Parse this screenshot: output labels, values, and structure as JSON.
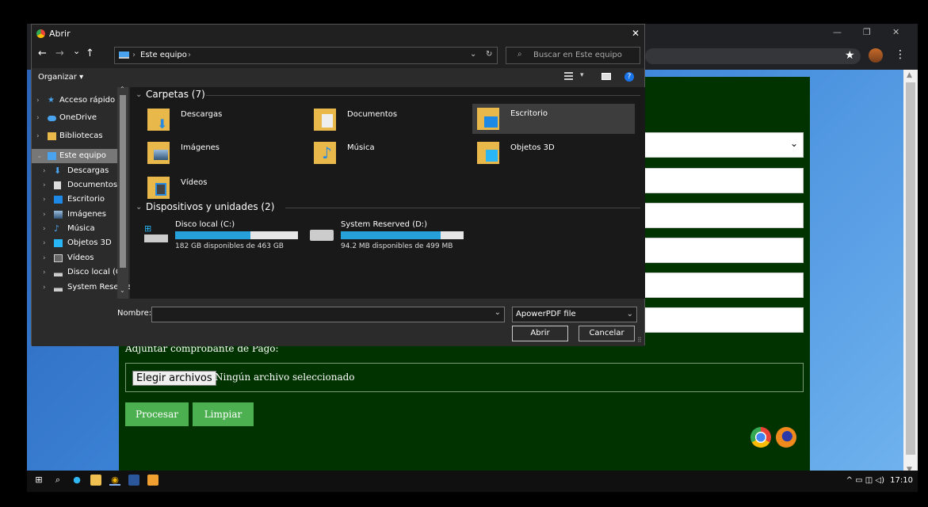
{
  "dialog": {
    "title": "Abrir",
    "close_glyph": "✕",
    "nav": {
      "back": "←",
      "forward": "→",
      "recent": "⌄",
      "up": "↑"
    },
    "breadcrumb": [
      "Este equipo"
    ],
    "search_placeholder": "Buscar en Este equipo",
    "toolbar": {
      "organize": "Organizar ▾"
    },
    "nav_pane": [
      {
        "label": "Acceso rápido",
        "icon": "star-icon"
      },
      {
        "label": "OneDrive",
        "icon": "cloud-icon"
      },
      {
        "label": "Bibliotecas",
        "icon": "library-icon"
      },
      {
        "label": "Este equipo",
        "icon": "computer-icon",
        "selected": true
      },
      {
        "label": "Descargas",
        "icon": "download-icon"
      },
      {
        "label": "Documentos",
        "icon": "document-icon"
      },
      {
        "label": "Escritorio",
        "icon": "desktop-icon"
      },
      {
        "label": "Imágenes",
        "icon": "image-icon"
      },
      {
        "label": "Música",
        "icon": "music-icon"
      },
      {
        "label": "Objetos 3D",
        "icon": "cube-icon"
      },
      {
        "label": "Vídeos",
        "icon": "video-icon"
      },
      {
        "label": "Disco local (C:)",
        "icon": "drive-icon"
      },
      {
        "label": "System Reserve",
        "icon": "drive-icon"
      }
    ],
    "folders_header": "Carpetas (7)",
    "folders": [
      {
        "label": "Descargas",
        "icon": "download-folder-icon"
      },
      {
        "label": "Documentos",
        "icon": "documents-folder-icon"
      },
      {
        "label": "Escritorio",
        "icon": "desktop-folder-icon",
        "selected": true
      },
      {
        "label": "Imágenes",
        "icon": "pictures-folder-icon"
      },
      {
        "label": "Música",
        "icon": "music-folder-icon"
      },
      {
        "label": "Objetos 3D",
        "icon": "3d-objects-folder-icon"
      },
      {
        "label": "Vídeos",
        "icon": "videos-folder-icon"
      }
    ],
    "devices_header": "Dispositivos y unidades (2)",
    "drives": [
      {
        "label": "Disco local (C:)",
        "space": "182 GB disponibles de 463 GB",
        "used_fraction": 0.61
      },
      {
        "label": "System Reserved (D:)",
        "space": "94.2 MB disponibles de 499 MB",
        "used_fraction": 0.81
      }
    ],
    "name_label": "Nombre:",
    "name_value": "",
    "filter_value": "ApowerPDF file",
    "open_button": "Abrir",
    "cancel_button": "Cancelar"
  },
  "page": {
    "attach_label": "Adjuntar comprobante de Pago:",
    "file_button": "Elegir archivos",
    "file_status": "Ningún archivo seleccionado",
    "process_button": "Procesar",
    "clear_button": "Limpiar"
  },
  "browser": {
    "window_controls": [
      "—",
      "❐",
      "✕"
    ]
  },
  "taskbar": {
    "time": "17:10"
  },
  "colors": {
    "form_bg": "#003300",
    "button_green": "#4caf50",
    "dialog_bg": "#2b2b2b",
    "selection": "#3d3d3d",
    "drive_bar": "#26a0da"
  }
}
